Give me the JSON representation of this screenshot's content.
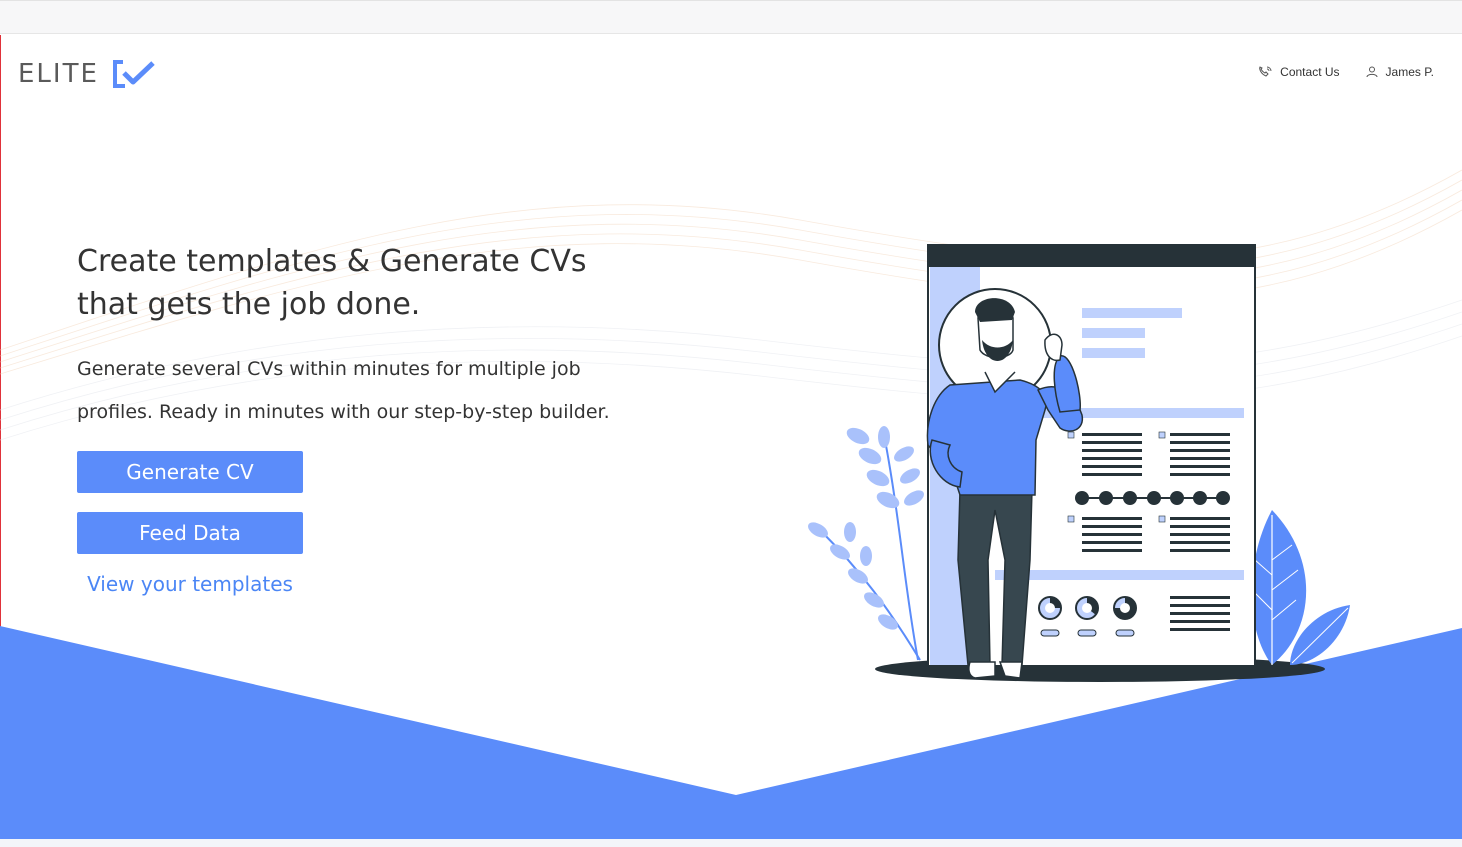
{
  "header": {
    "logo_text": "ELITE",
    "nav": {
      "contact_label": "Contact Us",
      "user_label": "James P."
    }
  },
  "hero": {
    "headline_line1": "Create templates & Generate CVs",
    "headline_line2": "that gets the job done.",
    "subtext_line1": "Generate several CVs within minutes for multiple job",
    "subtext_line2": "profiles. Ready in minutes with our step-by-step builder.",
    "primary_button": "Generate CV",
    "secondary_button": "Feed Data",
    "templates_link": "View your templates"
  },
  "icons": {
    "logo": "checkmark-bracket-icon",
    "contact": "phone-icon",
    "user": "user-icon"
  },
  "colors": {
    "accent": "#5b8cfa",
    "link": "#4b86f5",
    "dark": "#263238",
    "light_blue": "#bfd1fd"
  }
}
